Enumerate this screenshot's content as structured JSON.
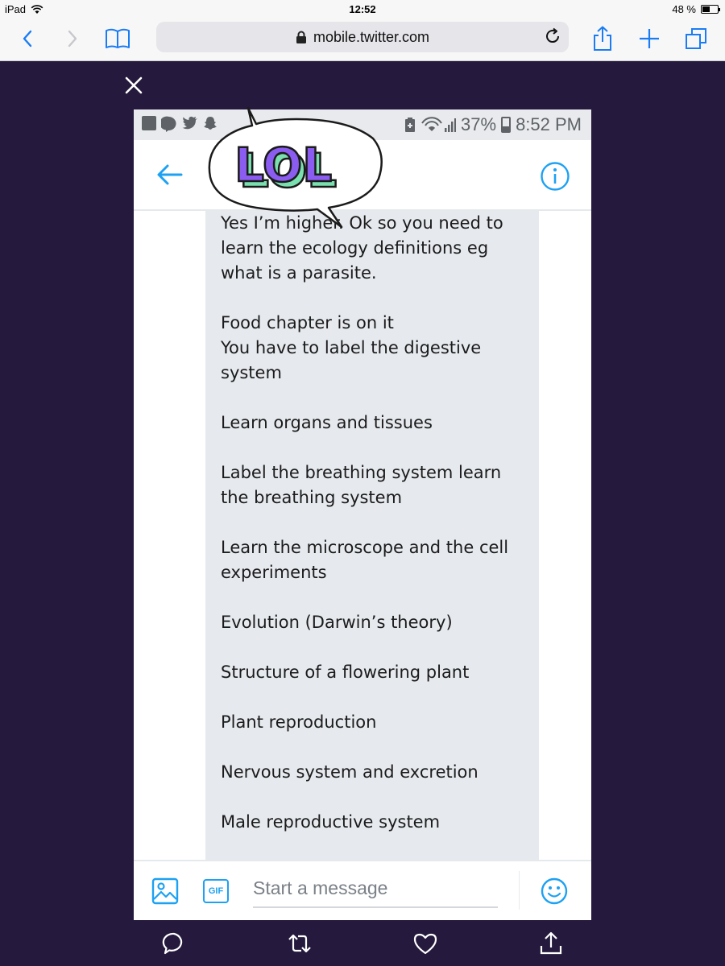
{
  "ipad_status": {
    "device": "iPad",
    "time": "12:52",
    "battery_text": "48 %",
    "battery_level": 0.48
  },
  "safari": {
    "url": "mobile.twitter.com",
    "icons": [
      "back-icon",
      "forward-icon",
      "bookmarks-icon",
      "lock-icon",
      "reload-icon",
      "share-icon",
      "new-tab-icon",
      "tabs-icon"
    ]
  },
  "overlay": {
    "close_icon": "close-icon"
  },
  "phone_status": {
    "battery_text": "37%",
    "time": "8:52 PM",
    "battery_level": 0.37
  },
  "header": {
    "back_icon": "arrow-left-icon",
    "info_icon": "info-icon"
  },
  "sticker": {
    "text": "LOL",
    "colors": {
      "fill": "#8a5cf0",
      "shadow": "#7be0b0"
    }
  },
  "message": {
    "paragraphs": [
      "Yes I’m higher. Ok so you need to learn the ecology definitions eg what is a parasite.",
      "Food chapter is on it",
      "You have to label the digestive system",
      "Learn organs and tissues",
      "Label the breathing system learn the breathing system",
      "Learn the microscope and the cell experiments",
      "Evolution (Darwin’s theory)",
      "Structure of a flowering plant",
      "Plant reproduction",
      "Nervous system and excretion",
      "Male reproductive system"
    ]
  },
  "composer": {
    "gif_label": "GIF",
    "placeholder": "Start a message"
  },
  "actions": [
    "reply-icon",
    "retweet-icon",
    "like-icon",
    "share-icon"
  ],
  "colors": {
    "accent": "#1da1f2",
    "overlay_bg": "#251a3d",
    "bubble_bg": "#e6e9ee"
  }
}
